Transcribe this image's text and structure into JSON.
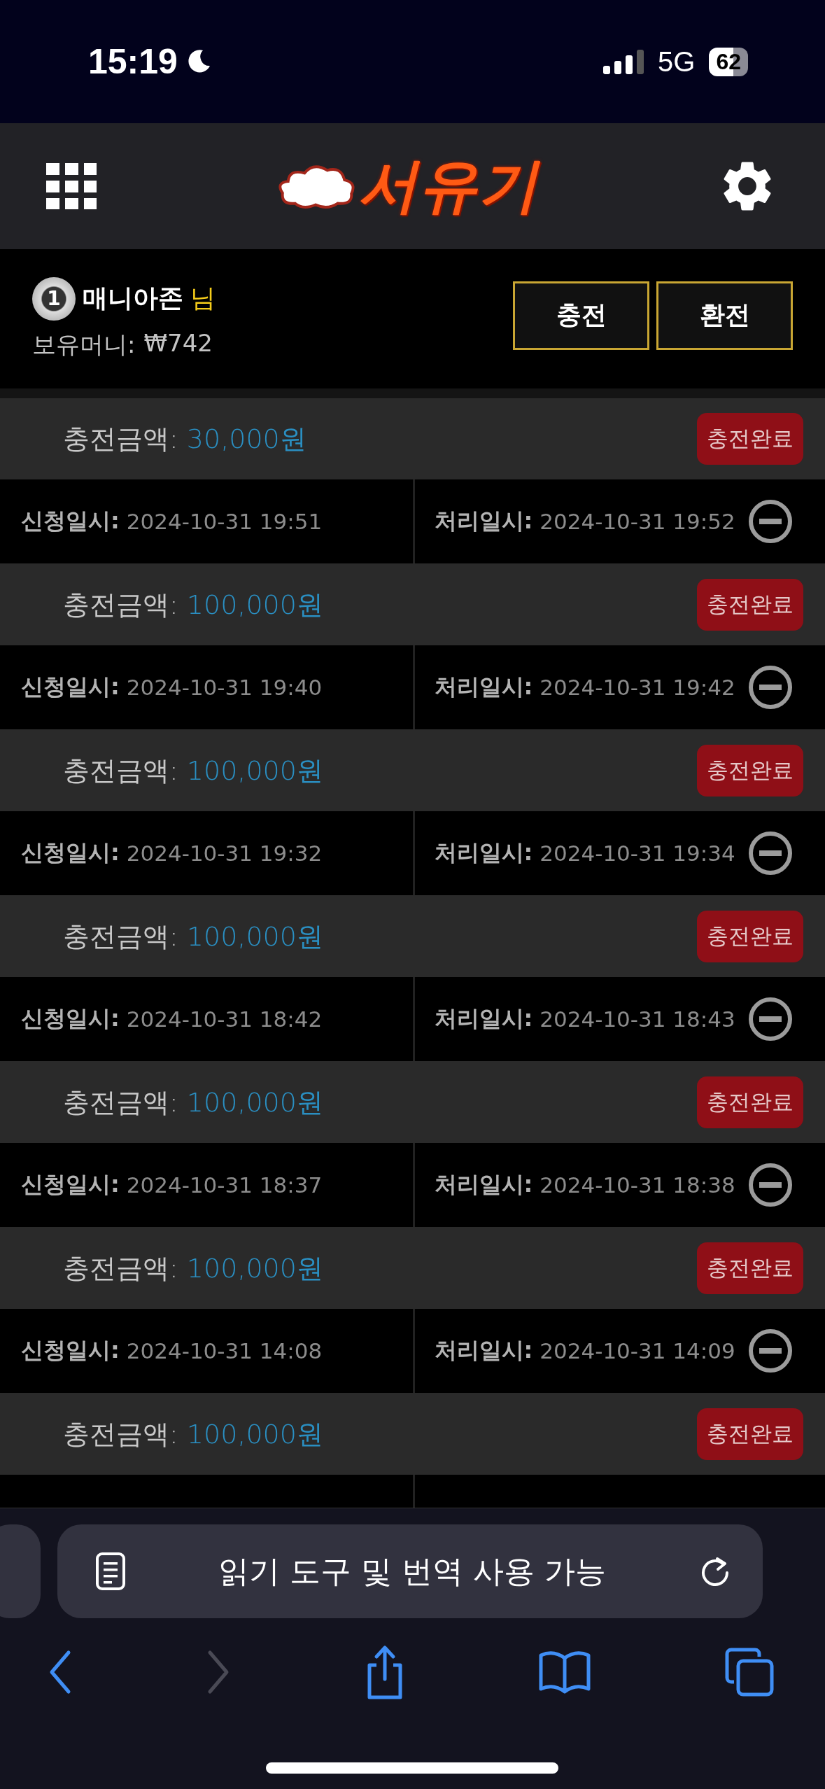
{
  "status_bar": {
    "time": "15:19",
    "network": "5G",
    "battery": "62"
  },
  "header": {
    "logo": "서유기"
  },
  "user": {
    "rank": "1",
    "name": "매니아존",
    "suffix": "님",
    "balance_label": "보유머니:",
    "balance": "₩742"
  },
  "actions": [
    "충전",
    "환전"
  ],
  "records": [
    {
      "amount_label": "충전금액:",
      "amount": "30,000원",
      "status": "충전완료",
      "request_label": "신청일시:",
      "request_time": "2024-10-31 19:51",
      "process_label": "처리일시:",
      "process_time": "2024-10-31 19:52"
    },
    {
      "amount_label": "충전금액:",
      "amount": "100,000원",
      "status": "충전완료",
      "request_label": "신청일시:",
      "request_time": "2024-10-31 19:40",
      "process_label": "처리일시:",
      "process_time": "2024-10-31 19:42"
    },
    {
      "amount_label": "충전금액:",
      "amount": "100,000원",
      "status": "충전완료",
      "request_label": "신청일시:",
      "request_time": "2024-10-31 19:32",
      "process_label": "처리일시:",
      "process_time": "2024-10-31 19:34"
    },
    {
      "amount_label": "충전금액:",
      "amount": "100,000원",
      "status": "충전완료",
      "request_label": "신청일시:",
      "request_time": "2024-10-31 18:42",
      "process_label": "처리일시:",
      "process_time": "2024-10-31 18:43"
    },
    {
      "amount_label": "충전금액:",
      "amount": "100,000원",
      "status": "충전완료",
      "request_label": "신청일시:",
      "request_time": "2024-10-31 18:37",
      "process_label": "처리일시:",
      "process_time": "2024-10-31 18:38"
    },
    {
      "amount_label": "충전금액:",
      "amount": "100,000원",
      "status": "충전완료",
      "request_label": "신청일시:",
      "request_time": "2024-10-31 14:08",
      "process_label": "처리일시:",
      "process_time": "2024-10-31 14:09"
    },
    {
      "amount_label": "충전금액:",
      "amount": "100,000원",
      "status": "충전완료"
    }
  ],
  "browser": {
    "address_text": "읽기 도구 및 번역 사용 가능",
    "forward_enabled": false
  }
}
